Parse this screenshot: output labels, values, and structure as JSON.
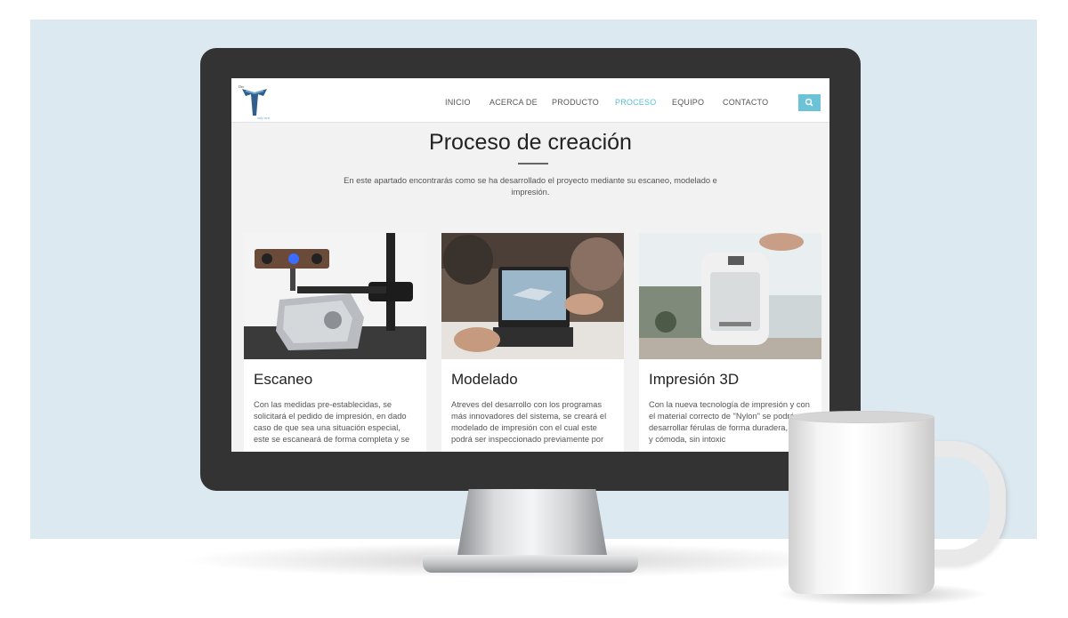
{
  "nav": {
    "items": [
      {
        "label": "INICIO",
        "active": false
      },
      {
        "label": "ACERCA DE",
        "active": false
      },
      {
        "label": "PRODUCTO",
        "active": false
      },
      {
        "label": "PROCESO",
        "active": true
      },
      {
        "label": "EQUIPO",
        "active": false
      },
      {
        "label": "CONTACTO",
        "active": false
      }
    ],
    "search_icon": "search-icon",
    "accent_color": "#5bbfd3"
  },
  "page": {
    "title": "Proceso de creación",
    "intro": "En este apartado encontrarás como se ha desarrollado el proyecto mediante su escaneo, modelado e impresión."
  },
  "cards": [
    {
      "title": "Escaneo",
      "text": "Con las medidas pre-establecidas, se solicitará el pedido de impresión, en dado caso de que sea una situación especial, este se escaneará de forma completa y se",
      "image": "3d-scanner-photo"
    },
    {
      "title": "Modelado",
      "text": "Atreves del desarrollo con los programas más innovadores del sistema, se creará el modelado de impresión con el cual este podrá ser inspeccionado previamente por",
      "image": "tablet-modeling-photo"
    },
    {
      "title": "Impresión 3D",
      "text": "Con la nueva tecnología de impresión y con el material correcto de \"Nylon\" se podrán desarrollar férulas de forma duradera, eficaz y cómoda, sin intoxic",
      "image": "3d-printer-photo"
    }
  ]
}
